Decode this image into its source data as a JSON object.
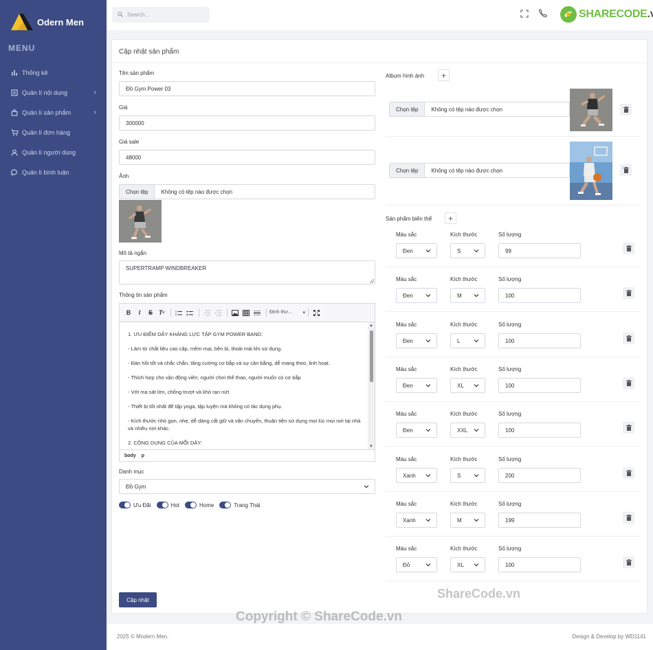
{
  "brand": {
    "name": "Odern Men"
  },
  "sidebar": {
    "menu_title": "MENU",
    "items": [
      {
        "label": "Thống kê",
        "icon": "bar-chart-icon",
        "chevron": false
      },
      {
        "label": "Quản lí nội dung",
        "icon": "document-icon",
        "chevron": true
      },
      {
        "label": "Quản lí sản phẩm",
        "icon": "bag-icon",
        "chevron": true
      },
      {
        "label": "Quản lí đơn hàng",
        "icon": "cart-icon",
        "chevron": false
      },
      {
        "label": "Quản lí người dùng",
        "icon": "user-icon",
        "chevron": false
      },
      {
        "label": "Quản lí bình luận",
        "icon": "chat-icon",
        "chevron": false
      }
    ]
  },
  "topbar": {
    "search_placeholder": "Search...",
    "watermark_main": "SHARECODE",
    "watermark_tld": ".vn"
  },
  "form": {
    "title": "Cập nhật sản phẩm",
    "name_label": "Tên sản phẩm",
    "name_value": "Đồ Gym Power 03",
    "price_label": "Giá",
    "price_value": "300000",
    "sale_label": "Giá sale",
    "sale_value": "48000",
    "image_label": "Ảnh",
    "file_button": "Chọn tệp",
    "file_none": "Không có tệp nào được chọn",
    "short_desc_label": "Mô tả ngắn",
    "short_desc_value": "SUPERTRAMP WINDBREAKER",
    "info_label": "Thông tin sản phẩm",
    "editor_format": "Định thư...",
    "editor_lines": [
      "1. ƯU ĐIỂM DÂY KHÁNG LỰC TẬP GYM POWER BAND:",
      "- Làm từ chất liệu cao cấp, mềm mại, bền bỉ, thoải mái khi sử dụng.",
      "- Đàn hồi tốt và chắc chắn, tăng cường cơ bắp và sự cân bằng, dễ mang theo, linh hoạt.",
      "- Thích hợp cho vận động viên, người chơi thể thao, người muốn có cơ bắp",
      "- Với ma sát lớn, chống trượt và khó rạn nứt",
      "- Thiết bị tốt nhất để tập yoga, tập luyện mà không có tác dụng phụ.",
      "- Kích thước nhỏ gọn, nhẹ, dễ dàng cất giữ và vận chuyển, thuận tiện sử dụng mọi lúc mọi nơi tại nhà và nhiều nơi khác.",
      "2. CÔNG DỤNG CỦA MỖI DÂY:"
    ],
    "editor_status": [
      "body",
      "p"
    ],
    "category_label": "Danh mục",
    "category_value": "Đồ Gym",
    "toggles": [
      "Ưu Đãi",
      "Hot",
      "Home",
      "Trang Thái"
    ],
    "submit": "Cập nhật"
  },
  "album": {
    "label": "Album hình ảnh",
    "plus": "+"
  },
  "variants": {
    "label": "Sản phẩm biến thể",
    "plus": "+",
    "color_label": "Màu sắc",
    "size_label": "Kích thước",
    "qty_label": "Số lượng",
    "rows": [
      {
        "color": "Đen",
        "size": "S",
        "qty": "99"
      },
      {
        "color": "Đen",
        "size": "M",
        "qty": "100"
      },
      {
        "color": "Đen",
        "size": "L",
        "qty": "100"
      },
      {
        "color": "Đen",
        "size": "XL",
        "qty": "100"
      },
      {
        "color": "Đen",
        "size": "XXL",
        "qty": "100"
      },
      {
        "color": "Xanh",
        "size": "S",
        "qty": "200"
      },
      {
        "color": "Xanh",
        "size": "M",
        "qty": "199"
      },
      {
        "color": "Đỏ",
        "size": "XL",
        "qty": "100"
      }
    ]
  },
  "footer": {
    "left": "2025 © Modern Men.",
    "right": "Design & Develop by WD1141"
  },
  "watermark": {
    "line1": "ShareCode.vn",
    "line2": "Copyright © ShareCode.vn"
  },
  "colors": {
    "sidebar": "#3c4b83",
    "accent": "#3c4b83",
    "watermark_green": "#6fbe44"
  }
}
